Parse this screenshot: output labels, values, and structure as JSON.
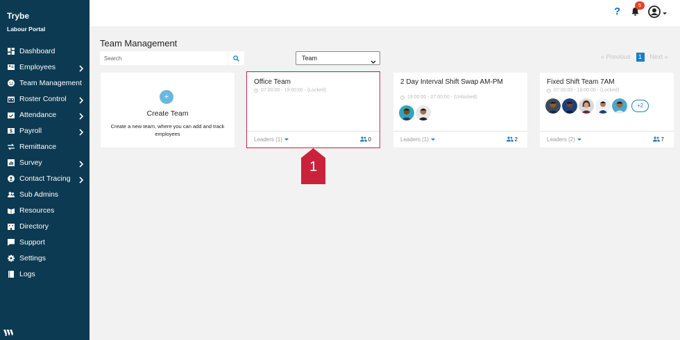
{
  "app": {
    "brand": "Trybe",
    "portal": "Labour Portal"
  },
  "sidebar": {
    "items": [
      {
        "label": "Dashboard",
        "icon": "dashboard-icon",
        "chevron": false
      },
      {
        "label": "Employees",
        "icon": "id-card-icon",
        "chevron": true
      },
      {
        "label": "Team Management",
        "icon": "smile-icon",
        "chevron": false
      },
      {
        "label": "Roster Control",
        "icon": "calendar-icon",
        "chevron": true
      },
      {
        "label": "Attendance",
        "icon": "calendar-check-icon",
        "chevron": true
      },
      {
        "label": "Payroll",
        "icon": "dollar-icon",
        "chevron": true
      },
      {
        "label": "Remittance",
        "icon": "exchange-icon",
        "chevron": false
      },
      {
        "label": "Survey",
        "icon": "chart-icon",
        "chevron": true
      },
      {
        "label": "Contact Tracing",
        "icon": "location-icon",
        "chevron": true
      },
      {
        "label": "Sub Admins",
        "icon": "users-icon",
        "chevron": false
      },
      {
        "label": "Resources",
        "icon": "book-open-icon",
        "chevron": false
      },
      {
        "label": "Directory",
        "icon": "building-icon",
        "chevron": false
      },
      {
        "label": "Support",
        "icon": "chat-icon",
        "chevron": false
      },
      {
        "label": "Settings",
        "icon": "gear-icon",
        "chevron": false
      },
      {
        "label": "Logs",
        "icon": "book-icon",
        "chevron": false
      }
    ]
  },
  "topbar": {
    "help": "?",
    "notifications_count": "5"
  },
  "page": {
    "title": "Team Management"
  },
  "search": {
    "placeholder": "Search"
  },
  "filter": {
    "selected": "Team"
  },
  "pagination": {
    "previous": "« Previous",
    "current": "1",
    "next": "Next »"
  },
  "create_card": {
    "plus": "+",
    "title": "Create Team",
    "description": "Create a new team, where you can add and track employees"
  },
  "teams": [
    {
      "name": "Office Team",
      "time": "07:00:00 - 19:00:00 - (Locked)",
      "leaders": "Leaders (1)",
      "members": "0"
    },
    {
      "name": "2 Day Interval Shift Swap AM-PM",
      "time": "19:00:00 - 07:00:00 - (Unlocked)",
      "leaders": "Leaders (1)",
      "members": "2"
    },
    {
      "name": "Fixed Shift Team 7AM",
      "time": "07:00:00 - 19:00:00 - (Locked)",
      "leaders": "Leaders (2)",
      "members": "7",
      "more": "+2"
    }
  ],
  "callout": {
    "number": "1"
  },
  "colors": {
    "sidebar": "#0c3a52",
    "accent": "#1a7fc4",
    "highlight": "#c9233c",
    "badge": "#e4432b"
  }
}
